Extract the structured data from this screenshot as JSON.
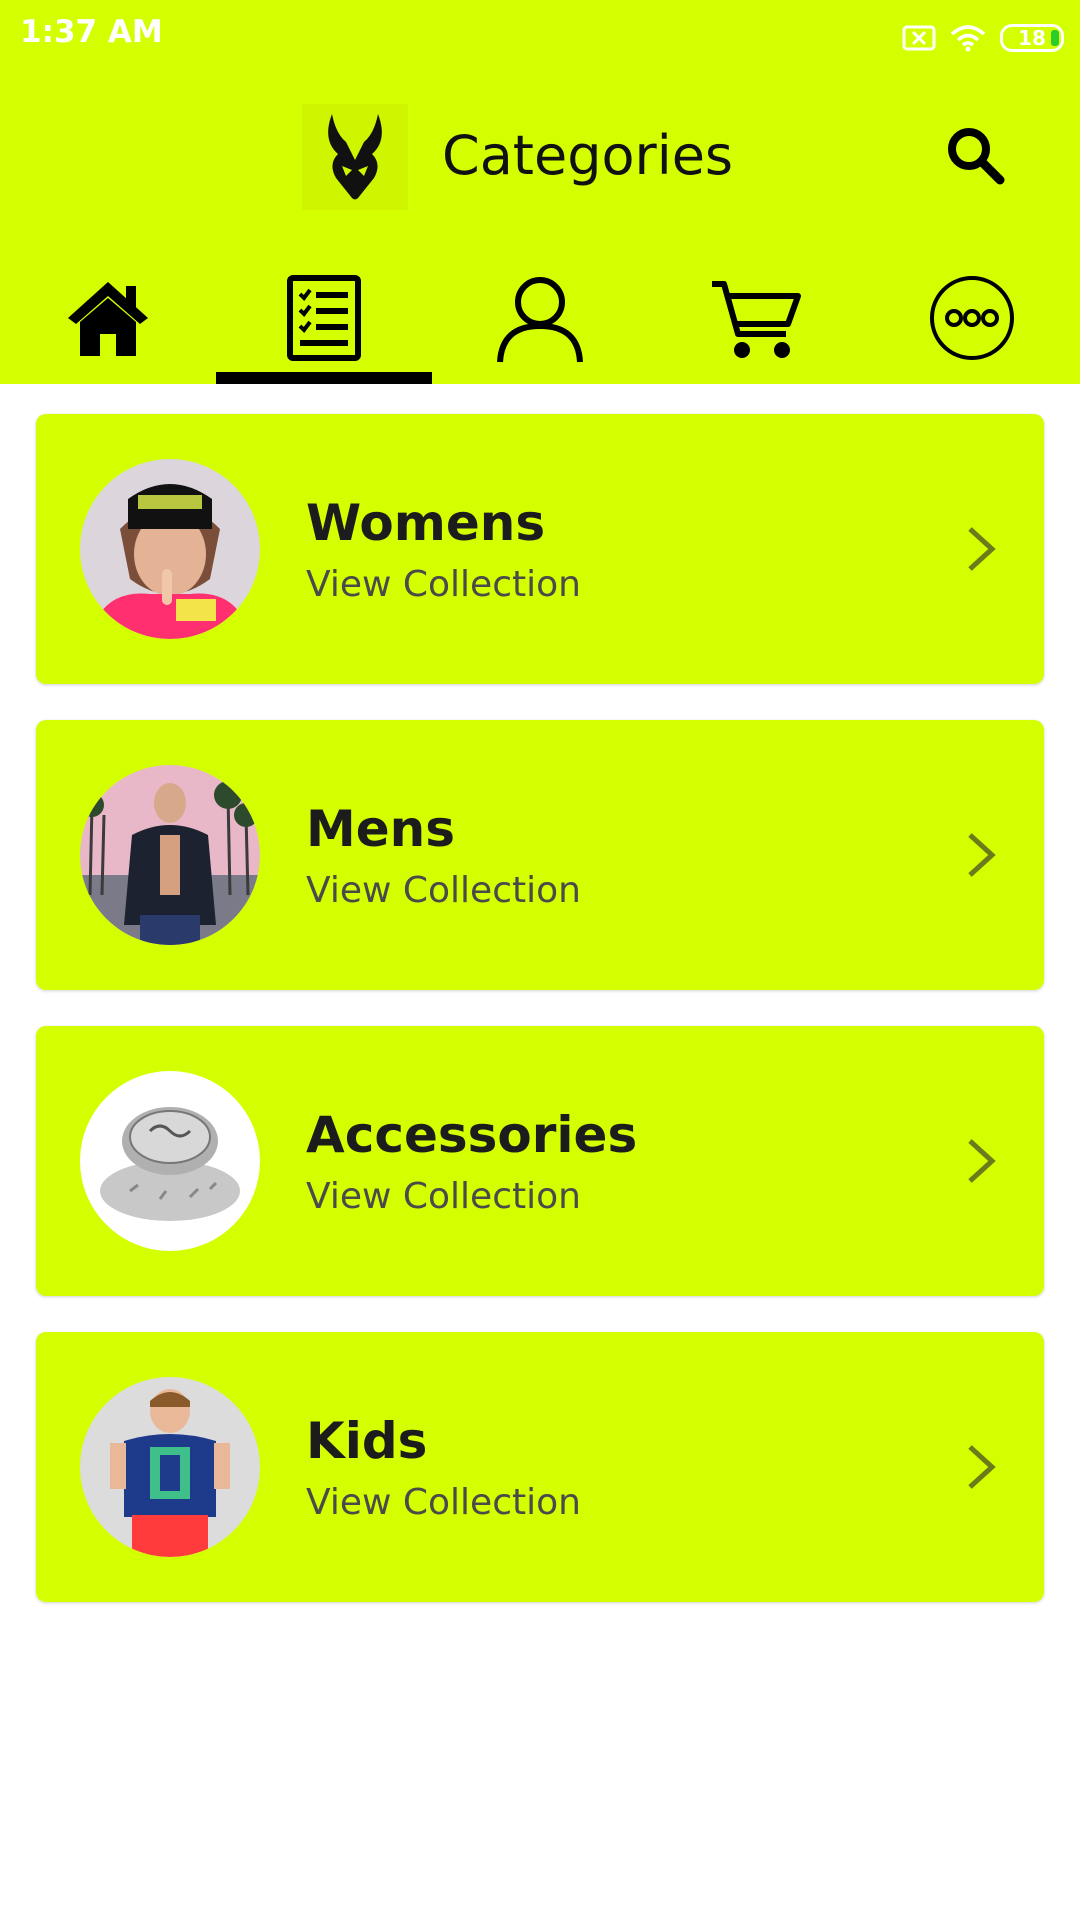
{
  "status": {
    "time": "1:37 AM",
    "battery": "18"
  },
  "header": {
    "title": "Categories"
  },
  "tabs": [
    "home-icon",
    "categories-icon",
    "profile-icon",
    "cart-icon",
    "more-icon"
  ],
  "categories": [
    {
      "name": "Womens",
      "subtitle": "View Collection",
      "image": "womens-photo"
    },
    {
      "name": "Mens",
      "subtitle": "View Collection",
      "image": "mens-photo"
    },
    {
      "name": "Accessories",
      "subtitle": "View Collection",
      "image": "accessories-photo"
    },
    {
      "name": "Kids",
      "subtitle": "View Collection",
      "image": "kids-photo"
    }
  ],
  "colors": {
    "accent": "#d4ff00",
    "text": "#111111",
    "subtext": "#4a4a4a"
  }
}
